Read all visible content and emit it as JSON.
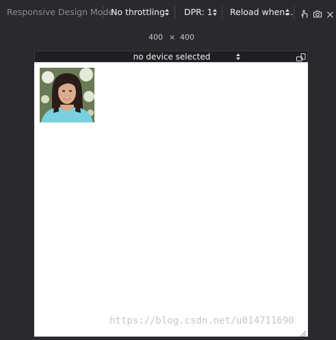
{
  "toolbar": {
    "title": "Responsive Design Mode",
    "throttling": "No throttling",
    "dpr": "DPR: 1",
    "reload": "Reload when..."
  },
  "dimensions": {
    "width": "400",
    "separator": "×",
    "height": "400"
  },
  "device": {
    "label": "no device selected"
  },
  "watermark": "https://blog.csdn.net/u014711690",
  "colors": {
    "toolbar_bg": "#2a2a2e",
    "viewport_bg": "#ffffff",
    "device_bar_bg": "#1f1f22"
  },
  "icons": [
    "touch-icon",
    "camera-icon",
    "close-icon",
    "rotate-icon"
  ]
}
